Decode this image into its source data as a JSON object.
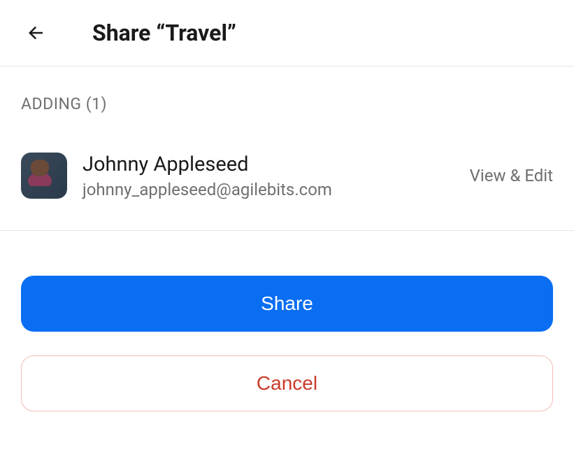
{
  "header": {
    "title": "Share “Travel”"
  },
  "section": {
    "label": "ADDING (1)"
  },
  "users": [
    {
      "name": "Johnny Appleseed",
      "email": "johnny_appleseed@agilebits.com",
      "permission": "View & Edit"
    }
  ],
  "actions": {
    "share_label": "Share",
    "cancel_label": "Cancel"
  }
}
